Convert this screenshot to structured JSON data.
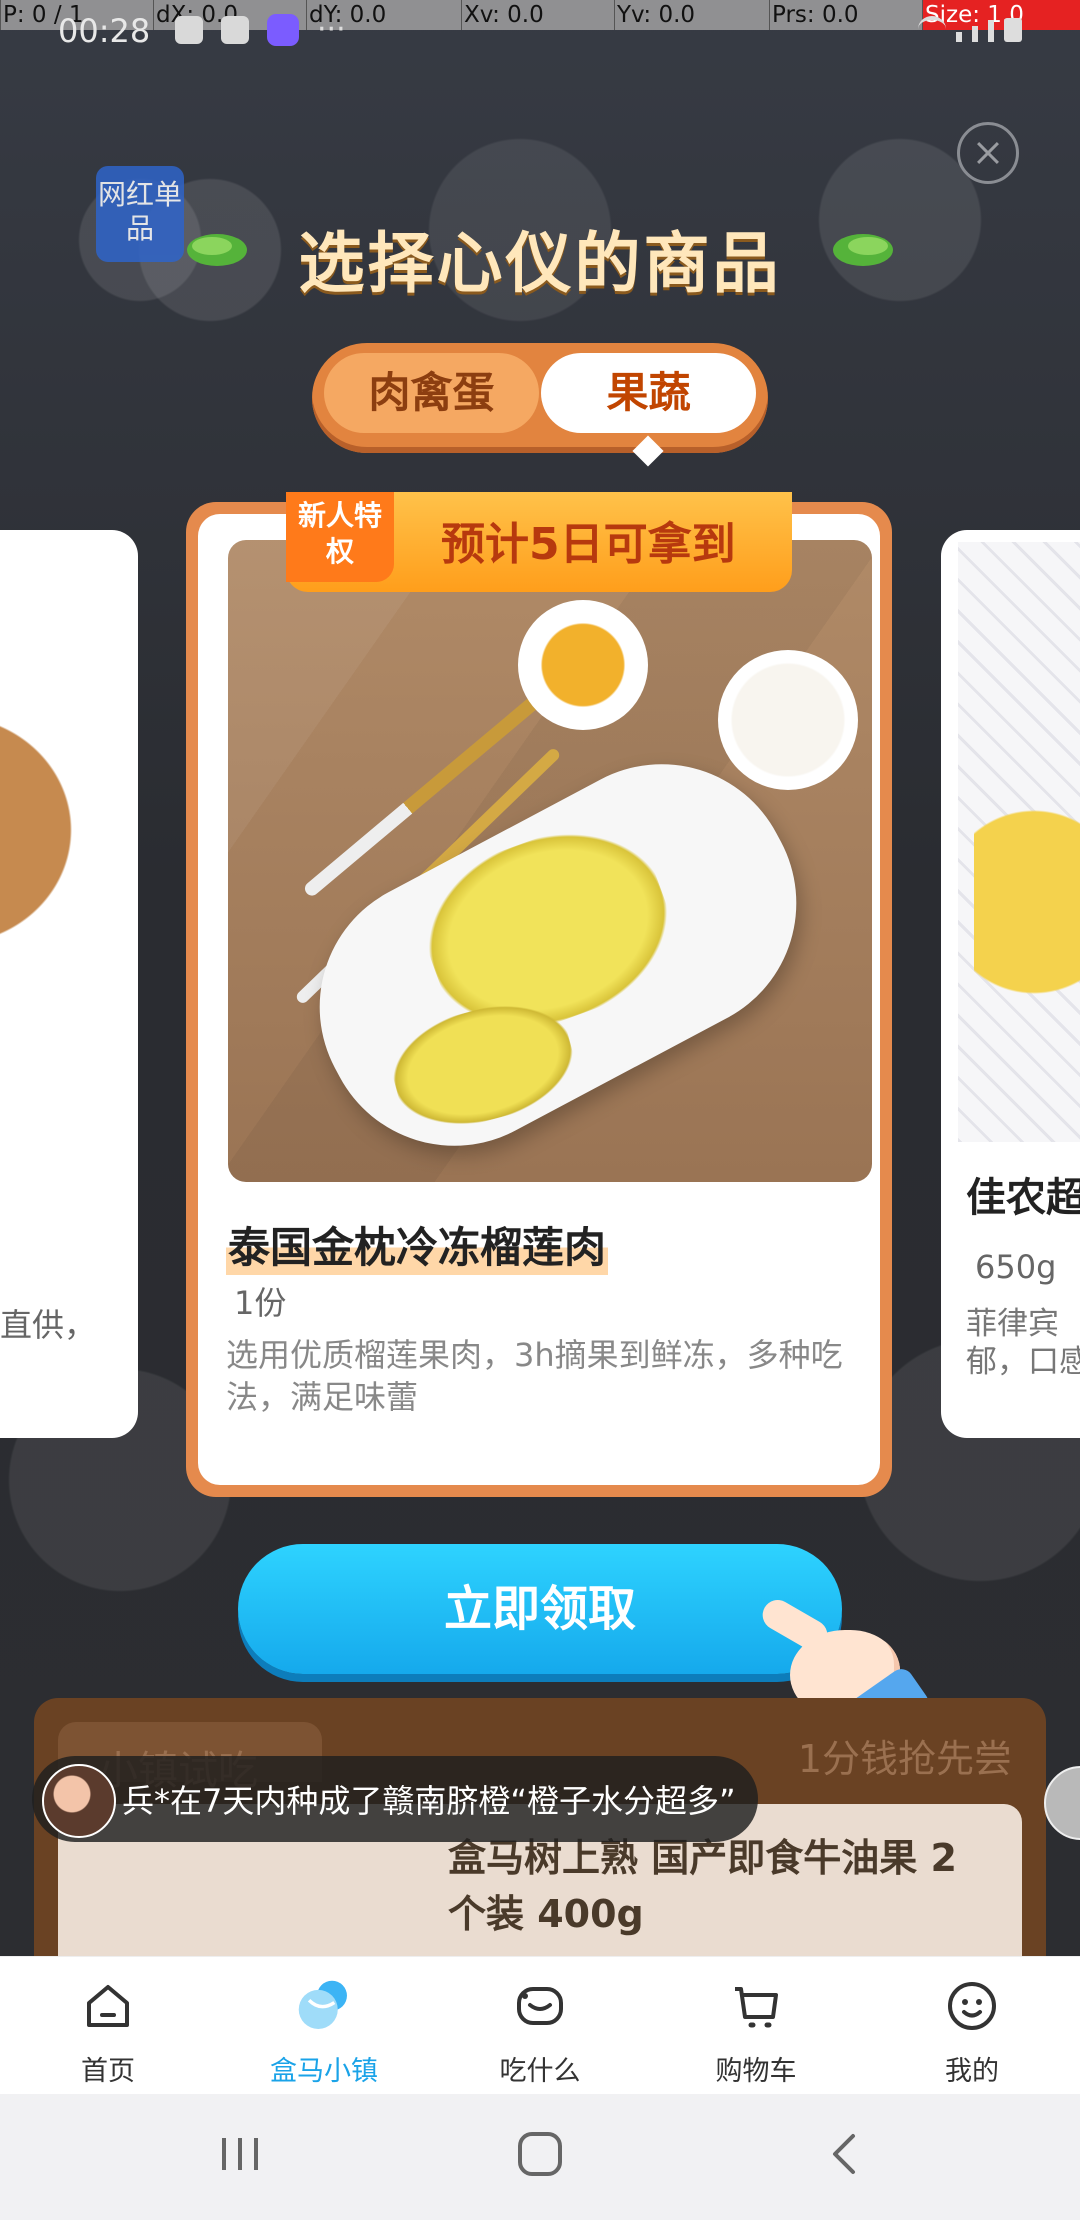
{
  "debug": {
    "p": "P: 0 / 1",
    "dx": "dX: 0.0",
    "dy": "dY: 0.0",
    "xv": "Xv: 0.0",
    "yv": "Yv: 0.0",
    "prs": "Prs: 0.0",
    "size": "Size: 1.0"
  },
  "status": {
    "time": "00:28"
  },
  "modal": {
    "title": "选择心仪的商品",
    "tabs": [
      {
        "label": "肉禽蛋",
        "active": false
      },
      {
        "label": "果蔬",
        "active": true
      }
    ]
  },
  "cards": {
    "left": {
      "desc_fragment": "直供，"
    },
    "main": {
      "badge": "新人特权",
      "delivery_text": "预计5日可拿到",
      "title": "泰国金枕冷冻榴莲肉",
      "quantity": "1份",
      "description": "选用优质榴莲果肉，3h摘果到鲜冻，多种吃法，满足味蕾"
    },
    "right": {
      "title_fragment": "佳农超",
      "weight": "650g",
      "desc_fragment": "菲律宾\n郁，口感"
    }
  },
  "cta": {
    "label": "立即领取"
  },
  "panel": {
    "tab_label": "小镇试吃",
    "right_label": "1分钱抢先尝",
    "badge": "网红单品",
    "product": "盒马树上熟 国产即食牛油果 2个装 400g"
  },
  "toast": {
    "message": "兵*在7天内种成了赣南脐橙“橙子水分超多”"
  },
  "nav": {
    "items": [
      {
        "label": "首页",
        "icon": "home-icon",
        "active": false
      },
      {
        "label": "盒马小镇",
        "icon": "town-icon",
        "active": true
      },
      {
        "label": "吃什么",
        "icon": "food-icon",
        "active": false
      },
      {
        "label": "购物车",
        "icon": "cart-icon",
        "active": false
      },
      {
        "label": "我的",
        "icon": "profile-icon",
        "active": false
      }
    ]
  },
  "colors": {
    "accent_blue": "#1aa3e8",
    "orange": "#e58a4d",
    "title": "#ffe7bb"
  }
}
